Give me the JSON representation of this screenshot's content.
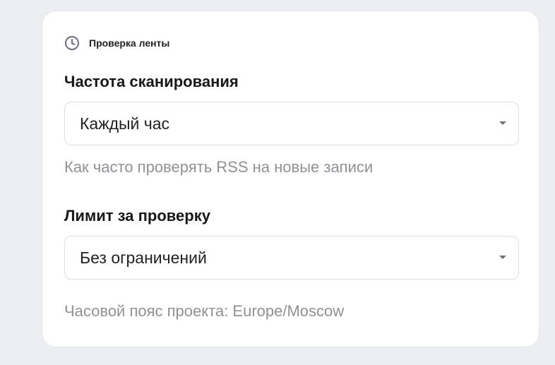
{
  "card": {
    "title": "Проверка ленты",
    "title_icon": "clock-icon"
  },
  "frequency": {
    "label": "Частота сканирования",
    "selected": "Каждый час",
    "hint": "Как часто проверять RSS на новые записи"
  },
  "limit": {
    "label": "Лимит за проверку",
    "selected": "Без ограничений"
  },
  "timezone_note": "Часовой пояс проекта: Europe/Moscow",
  "colors": {
    "background": "#eceef2",
    "card": "#ffffff",
    "icon": "#6b6b82",
    "hint_text": "#8e9297"
  }
}
